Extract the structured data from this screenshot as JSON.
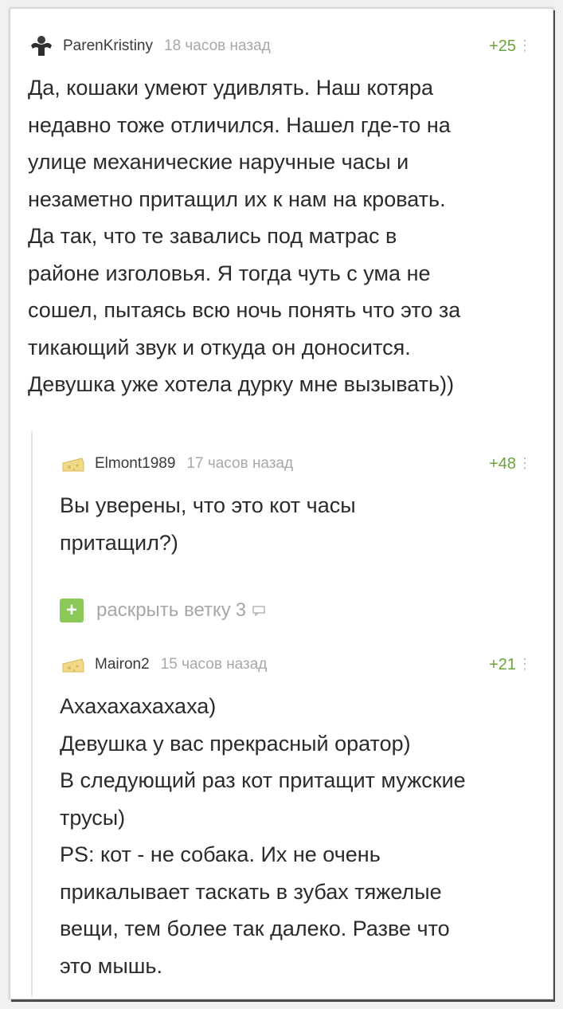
{
  "comments": [
    {
      "author": "ParenKristiny",
      "time": "18 часов назад",
      "rating": "+25",
      "text": "Да, кошаки умеют удивлять. Наш котяра\nнедавно тоже отличился. Нашел где-то на\nулице механические наручные часы и\nнезаметно притащил их к нам на кровать.\nДа так, что те завались под матрас в\nрайоне изголовья. Я тогда чуть с ума не\nсошел, пытаясь всю ночь понять что это за\nтикающий звук и откуда он доносится.\nДевушка уже хотела дурку мне вызывать))"
    },
    {
      "author": "Elmont1989",
      "time": "17 часов назад",
      "rating": "+48",
      "text": "Вы уверены, что это кот часы\nпритащил?)"
    },
    {
      "author": "Mairon2",
      "time": "15 часов назад",
      "rating": "+21",
      "text": "Ахахахахахаха)\nДевушка у вас прекрасный оратор)\nВ следующий раз кот притащит мужские\nтрусы)\nPS: кот - не собака. Их не очень\nприкалывает таскать в зубах тяжелые\nвещи, тем более так далеко. Разве что\nэто мышь."
    }
  ],
  "expand_thread": {
    "label": "раскрыть ветку",
    "count": "3"
  },
  "icons": {
    "more": "more-vertical-icon",
    "expand": "plus-icon",
    "chat": "chat-bubble-icon",
    "avatar_main": "bodybuilder-avatar-icon",
    "avatar_default": "cheese-avatar-icon"
  },
  "colors": {
    "rating": "#6ba33c",
    "expand_button": "#8ac858",
    "muted": "#a8a8a8"
  }
}
